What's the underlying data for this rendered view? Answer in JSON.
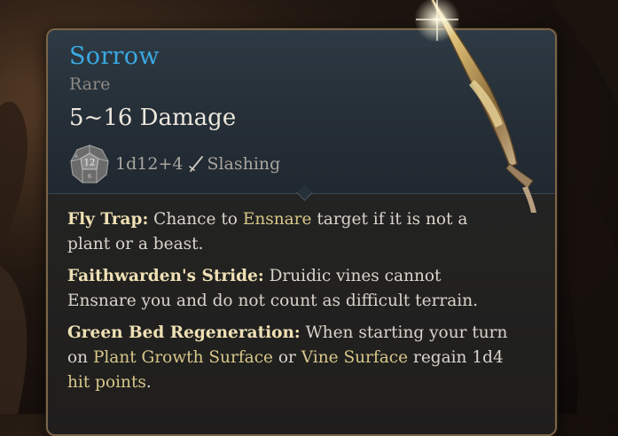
{
  "item": {
    "name": "Sorrow",
    "rarity": "Rare",
    "damage": "5~16 Damage",
    "dice_face": "12",
    "dice_small_a": "6",
    "dice_small_b": "9",
    "dice": "1d12+4",
    "damage_type": "Slashing"
  },
  "effects": [
    {
      "title": "Fly Trap:",
      "t1": " Chance to ",
      "k1": "Ensnare",
      "t2": " target if it is not a plant or a beast."
    },
    {
      "title": "Faithwarden's Stride:",
      "t1": " Druidic vines cannot Ensnare you and do not count as difficult terrain."
    },
    {
      "title": "Green Bed Regeneration:",
      "t1": " When starting your turn on ",
      "k1": "Plant Growth Surface",
      "t2": " or ",
      "k2": "Vine Surface",
      "t3": " regain 1d4 ",
      "k3": "hit points",
      "t4": "."
    }
  ],
  "colors": {
    "name": "#3aa8e0",
    "keyword": "#d8c789",
    "title": "#efe0b4",
    "border": "#7a6446"
  },
  "icons": [
    "d12-die-icon",
    "sword-icon",
    "glaive-blade-icon"
  ]
}
